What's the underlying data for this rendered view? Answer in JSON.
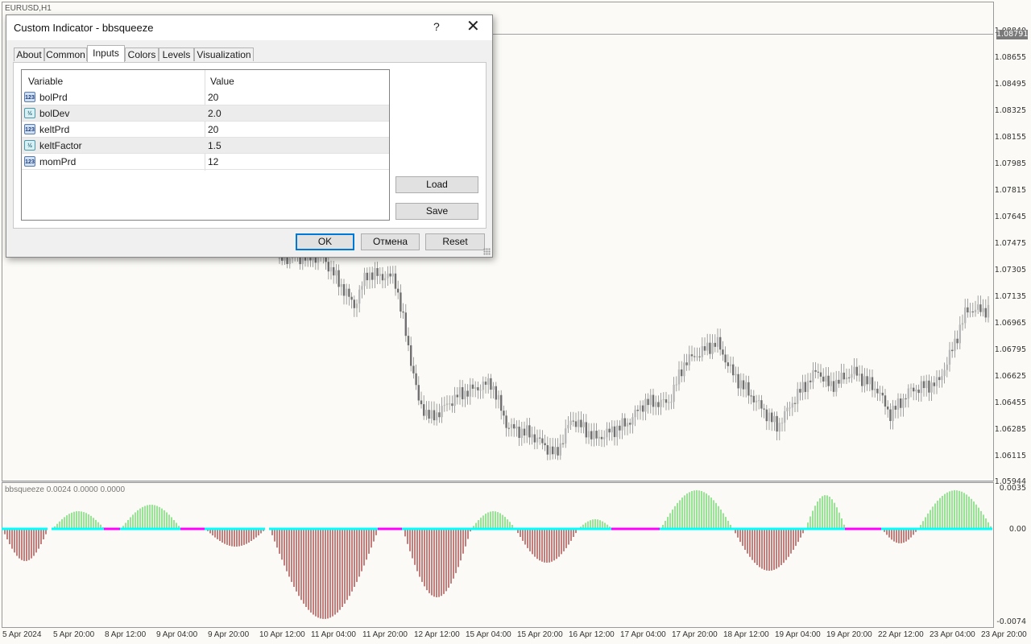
{
  "chart": {
    "title": "EURUSD,H1",
    "indicator_label": "bbsqueeze 0.0024 0.0000 0.0000",
    "price_axis": [
      "1.08840",
      "1.08655",
      "1.08495",
      "1.08325",
      "1.08155",
      "1.07985",
      "1.07815",
      "1.07645",
      "1.07475",
      "1.07305",
      "1.07135",
      "1.06965",
      "1.06795",
      "1.06625",
      "1.06455",
      "1.06285",
      "1.06115",
      "1.05944"
    ],
    "current_price": "1.08791",
    "indicator_axis": [
      "0.0035",
      "0.00",
      "-0.0074"
    ],
    "time_axis": [
      "5 Apr 2024",
      "5 Apr 20:00",
      "8 Apr 12:00",
      "9 Apr 04:00",
      "9 Apr 20:00",
      "10 Apr 12:00",
      "11 Apr 04:00",
      "11 Apr 20:00",
      "12 Apr 12:00",
      "15 Apr 04:00",
      "15 Apr 20:00",
      "16 Apr 12:00",
      "17 Apr 04:00",
      "17 Apr 20:00",
      "18 Apr 12:00",
      "19 Apr 04:00",
      "19 Apr 20:00",
      "22 Apr 12:00",
      "23 Apr 04:00",
      "23 Apr 20:00"
    ],
    "colors": {
      "candle": "#8a8a8a",
      "hist_up": "#32cd32",
      "hist_down": "#8b0000",
      "dot_on": "#00ffff",
      "dot_off": "#ff00ff"
    }
  },
  "dialog": {
    "title": "Custom Indicator - bbsqueeze",
    "help": "?",
    "close": "✕",
    "tabs": [
      "About",
      "Common",
      "Inputs",
      "Colors",
      "Levels",
      "Visualization"
    ],
    "active_tab": "Inputs",
    "columns": {
      "variable": "Variable",
      "value": "Value"
    },
    "rows": [
      {
        "name": "bolPrd",
        "value": "20",
        "icon": "123"
      },
      {
        "name": "bolDev",
        "value": "2.0",
        "icon": "½"
      },
      {
        "name": "keltPrd",
        "value": "20",
        "icon": "123"
      },
      {
        "name": "keltFactor",
        "value": "1.5",
        "icon": "½"
      },
      {
        "name": "momPrd",
        "value": "12",
        "icon": "123"
      }
    ],
    "buttons": {
      "load": "Load",
      "save": "Save",
      "ok": "OK",
      "cancel": "Отмена",
      "reset": "Reset"
    }
  }
}
